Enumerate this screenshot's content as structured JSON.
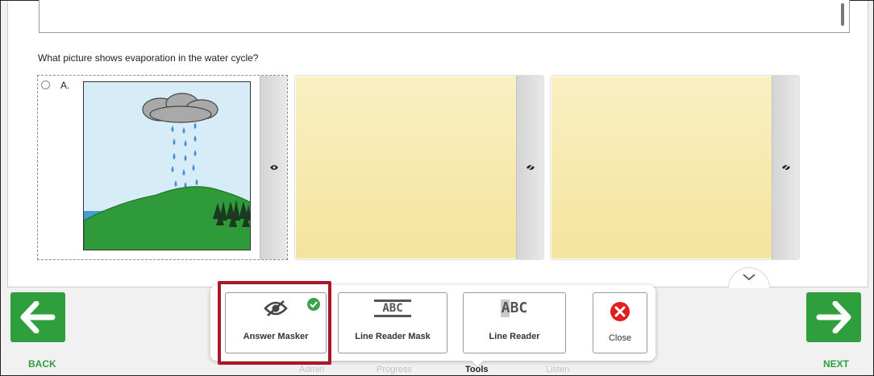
{
  "question": {
    "text": "What picture shows evaporation in the water cycle?"
  },
  "options": [
    {
      "letter": "A.",
      "visible": true,
      "image": "rain-cloud-over-hill"
    },
    {
      "letter": "",
      "visible": false
    },
    {
      "letter": "",
      "visible": false
    }
  ],
  "nav": {
    "back_label": "BACK",
    "next_label": "NEXT"
  },
  "toolbar": {
    "answer_masker": "Answer Masker",
    "line_reader_mask": "Line Reader Mask",
    "line_reader": "Line Reader",
    "close": "Close",
    "line_reader_mask_icon_text": "ABC",
    "line_reader_icon_text": "ABC"
  },
  "tabs": [
    {
      "label": "Admin",
      "active": false
    },
    {
      "label": "Progress",
      "active": false
    },
    {
      "label": "Tools",
      "active": true
    },
    {
      "label": "Listen",
      "active": false
    }
  ],
  "colors": {
    "nav_green": "#2f9e3c",
    "selected_outline": "#a8182a",
    "close_red": "#e02020",
    "masked_yellow": "#f5e49e",
    "check_green": "#3aa34b"
  }
}
